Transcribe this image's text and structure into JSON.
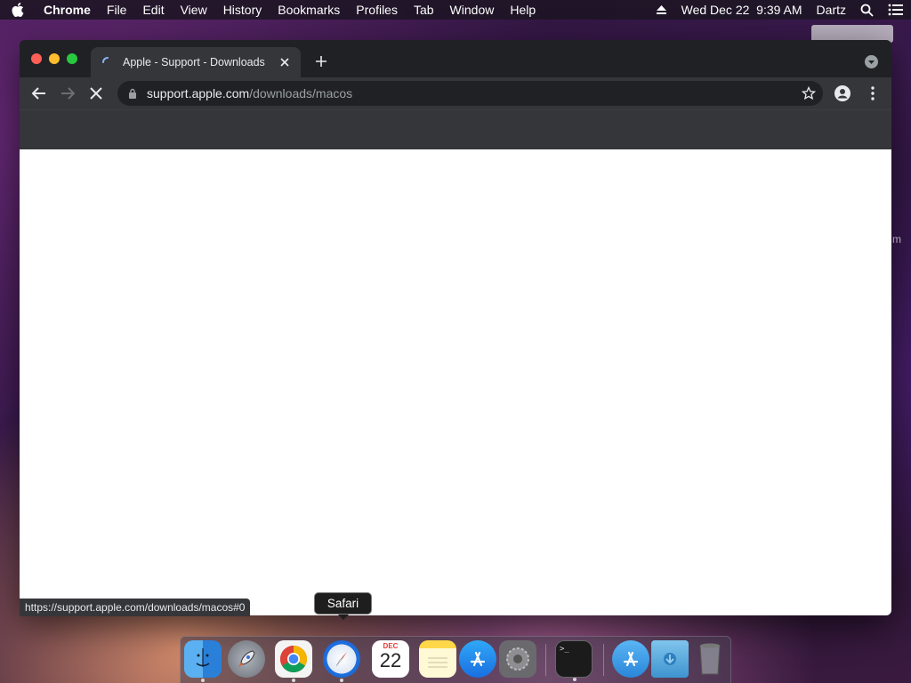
{
  "menubar": {
    "app_name": "Chrome",
    "items": [
      "File",
      "Edit",
      "View",
      "History",
      "Bookmarks",
      "Profiles",
      "Tab",
      "Window",
      "Help"
    ],
    "datetime": "Wed Dec 22  9:39 AM",
    "user": "Dartz",
    "icons": [
      "apple-icon",
      "eject-icon",
      "spotlight-search-icon",
      "control-center-list-icon"
    ]
  },
  "browser": {
    "tab": {
      "title": "Apple - Support - Downloads",
      "loading": true
    },
    "omnibox": {
      "host": "support.apple.com",
      "path": "/downloads/macos"
    },
    "status_url": "https://support.apple.com/downloads/macos#0"
  },
  "dock": {
    "tooltip": "Safari",
    "apps": [
      {
        "name": "Finder",
        "icon": "finder-icon",
        "running": true
      },
      {
        "name": "Launchpad",
        "icon": "launchpad-rocket-icon",
        "running": false
      },
      {
        "name": "Google Chrome",
        "icon": "chrome-icon",
        "running": true
      },
      {
        "name": "Safari",
        "icon": "safari-compass-icon",
        "running": true
      },
      {
        "name": "Calendar",
        "icon": "calendar-icon",
        "running": false,
        "month": "DEC",
        "day": "22"
      },
      {
        "name": "Notes",
        "icon": "notes-icon",
        "running": false
      },
      {
        "name": "App Store",
        "icon": "app-store-icon",
        "running": false
      },
      {
        "name": "System Preferences",
        "icon": "gear-icon",
        "running": false
      },
      {
        "name": "Terminal",
        "icon": "terminal-icon",
        "running": true,
        "prompt": ">_"
      },
      {
        "name": "Applications",
        "icon": "applications-folder-icon",
        "running": false
      },
      {
        "name": "Downloads",
        "icon": "downloads-folder-icon",
        "running": false
      },
      {
        "name": "Trash",
        "icon": "trash-icon",
        "running": false
      }
    ]
  },
  "colors": {
    "chrome_dark": "#202124",
    "chrome_toolbar": "#35363a",
    "url_path_gray": "#9aa0a6",
    "close_red": "#fe5f57",
    "minimize_yellow": "#febc2e",
    "maximize_green": "#28c840"
  }
}
